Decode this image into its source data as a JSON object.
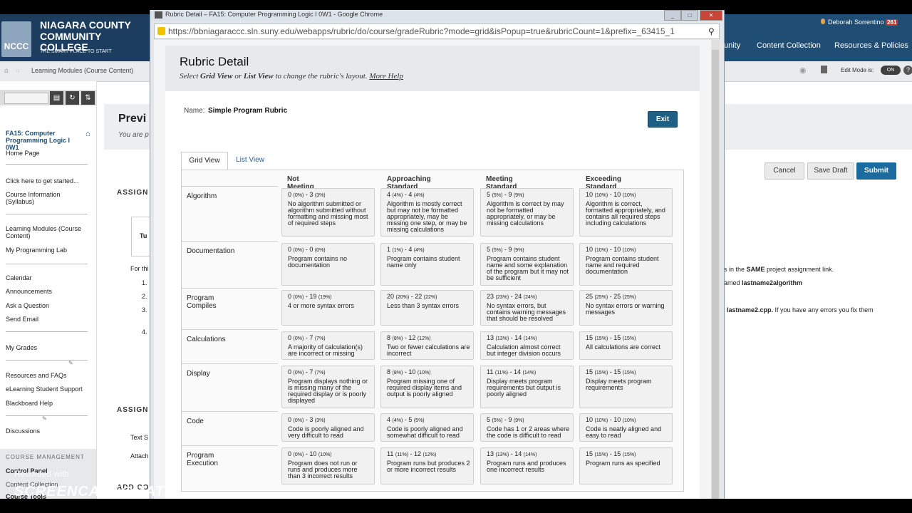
{
  "bg": {
    "college_line1": "NIAGARA COUNTY",
    "college_line2": "COMMUNITY COLLEGE",
    "tagline": "THE SMART PLACE TO START",
    "logo_text": "NCCC",
    "nav": [
      "unity",
      "Content Collection",
      "Resources & Policies"
    ],
    "user_name": "Deborah Sorrentino",
    "user_count": "261",
    "breadcrumb": "Learning Modules (Course Content)",
    "edit_mode_label": "Edit Mode is:",
    "edit_mode_value": "ON",
    "course_title": "FA15: Computer Programming Logic I 0W1",
    "sidebar_groups": [
      [
        "Home Page"
      ],
      [
        "Click here to get started...",
        "Course Information (Syllabus)"
      ],
      [
        "Learning Modules (Course Content)",
        "My Programming Lab"
      ],
      [
        "Calendar",
        "Announcements",
        "Ask a Question",
        "Send Email"
      ],
      [
        "My Grades"
      ],
      [
        "Resources and FAQs",
        "eLearning Student Support",
        "Blackboard Help"
      ],
      [
        "Discussions"
      ]
    ],
    "course_management": "COURSE MANAGEMENT",
    "control_panel": "Control Panel",
    "content_collection": "Content Collection",
    "course_tools": "Course Tools",
    "preview_title": "Previ",
    "preview_sub": "You are p",
    "buttons": {
      "cancel": "Cancel",
      "save_draft": "Save Draft",
      "submit": "Submit"
    },
    "assign_h1": "ASSIGN",
    "assign_h2": "ASSIGN",
    "add_h": "ADD CO",
    "tu": "Tu",
    "for_text": "For thi",
    "list_nums": [
      "1.",
      "2.",
      "3.",
      "4."
    ],
    "text_s": "Text S",
    "attach": "Attach",
    "same_text_pre": "s in the ",
    "same_text_bold": "SAME",
    "same_text_post": " project assignment link.",
    "named_pre": "amed ",
    "named_bold": "lastname2algorithm",
    "errors_bold": "lastname2.cpp.",
    "errors_post": "  If you have any errors you fix them"
  },
  "popup": {
    "window_title": "Rubric Detail – FA15: Computer Programming Logic I 0W1 - Google Chrome",
    "url": "https://bbniagaraccc.sln.suny.edu/webapps/rubric/do/course/gradeRubric?mode=grid&isPopup=true&rubricCount=1&prefix=_63415_1",
    "heading": "Rubric Detail",
    "sub_pre": "Select ",
    "sub_grid": "Grid View",
    "sub_mid": " or ",
    "sub_list": "List View",
    "sub_post": " to change the rubric's layout.",
    "more_help": "More Help",
    "name_label": "Name:",
    "name_value": "Simple Program Rubric",
    "exit": "Exit",
    "tab_grid": "Grid View",
    "tab_list": "List View"
  },
  "rubric": {
    "columns": [
      "Not Meeting Standard",
      "Approaching Standard",
      "Meeting Standard",
      "Exceeding Standard"
    ],
    "rows": [
      {
        "name": "Algorithm",
        "cells": [
          {
            "pts": "0",
            "pct": "(0%)",
            "pts2": "3",
            "pct2": "(3%)",
            "desc": "No algorithm submitted or algorithm submitted without formatting and missing most of required steps"
          },
          {
            "pts": "4",
            "pct": "(4%)",
            "pts2": "4",
            "pct2": "(4%)",
            "desc": "Algorithm is mostly correct but may not be formatted appropriately, may be missing one step, or may be missing calculations"
          },
          {
            "pts": "5",
            "pct": "(5%)",
            "pts2": "9",
            "pct2": "(9%)",
            "desc": "Algorithm is correct by may not be formatted appropriately, or may be missing calculations"
          },
          {
            "pts": "10",
            "pct": "(10%)",
            "pts2": "10",
            "pct2": "(10%)",
            "desc": "Algorithm is correct, formatted appropriately, and contains all required steps including calculations"
          }
        ]
      },
      {
        "name": "Documentation",
        "cells": [
          {
            "pts": "0",
            "pct": "(0%)",
            "pts2": "0",
            "pct2": "(0%)",
            "desc": "Program contains no documentation"
          },
          {
            "pts": "1",
            "pct": "(1%)",
            "pts2": "4",
            "pct2": "(4%)",
            "desc": "Program contains student name only"
          },
          {
            "pts": "5",
            "pct": "(5%)",
            "pts2": "9",
            "pct2": "(9%)",
            "desc": "Program contains student name and some explanation of the program but it may not be sufficient"
          },
          {
            "pts": "10",
            "pct": "(10%)",
            "pts2": "10",
            "pct2": "(10%)",
            "desc": "Program contains student name and required documentation"
          }
        ]
      },
      {
        "name": "Program Compiles",
        "cells": [
          {
            "pts": "0",
            "pct": "(0%)",
            "pts2": "19",
            "pct2": "(19%)",
            "desc": "4 or more syntax errors"
          },
          {
            "pts": "20",
            "pct": "(20%)",
            "pts2": "22",
            "pct2": "(22%)",
            "desc": "Less than 3 syntax errors"
          },
          {
            "pts": "23",
            "pct": "(23%)",
            "pts2": "24",
            "pct2": "(24%)",
            "desc": "No syntax errors, but contains warning messages that should be resolved"
          },
          {
            "pts": "25",
            "pct": "(25%)",
            "pts2": "25",
            "pct2": "(25%)",
            "desc": "No syntax errors or warning messages"
          }
        ]
      },
      {
        "name": "Calculations",
        "cells": [
          {
            "pts": "0",
            "pct": "(0%)",
            "pts2": "7",
            "pct2": "(7%)",
            "desc": "A majority of calculation(s) are incorrect or missing"
          },
          {
            "pts": "8",
            "pct": "(8%)",
            "pts2": "12",
            "pct2": "(12%)",
            "desc": "Two or fewer calculations are incorrect"
          },
          {
            "pts": "13",
            "pct": "(13%)",
            "pts2": "14",
            "pct2": "(14%)",
            "desc": "Calculation almost correct but integer division occurs"
          },
          {
            "pts": "15",
            "pct": "(15%)",
            "pts2": "15",
            "pct2": "(15%)",
            "desc": "All calculations are correct"
          }
        ]
      },
      {
        "name": "Display",
        "cells": [
          {
            "pts": "0",
            "pct": "(0%)",
            "pts2": "7",
            "pct2": "(7%)",
            "desc": "Program displays nothing or is missing many of the required display or is poorly displayed"
          },
          {
            "pts": "8",
            "pct": "(8%)",
            "pts2": "10",
            "pct2": "(10%)",
            "desc": "Program missing one of required display items and output is poorly aligned"
          },
          {
            "pts": "11",
            "pct": "(11%)",
            "pts2": "14",
            "pct2": "(14%)",
            "desc": "Display meets program requirements but output is poorly aligned"
          },
          {
            "pts": "15",
            "pct": "(15%)",
            "pts2": "15",
            "pct2": "(15%)",
            "desc": "Display meets program requirements"
          }
        ]
      },
      {
        "name": "Code",
        "cells": [
          {
            "pts": "0",
            "pct": "(0%)",
            "pts2": "3",
            "pct2": "(3%)",
            "desc": "Code is poorly aligned and very difficult to read"
          },
          {
            "pts": "4",
            "pct": "(4%)",
            "pts2": "5",
            "pct2": "(5%)",
            "desc": "Code is poorly aligned and somewhat difficult to read"
          },
          {
            "pts": "5",
            "pct": "(5%)",
            "pts2": "9",
            "pct2": "(9%)",
            "desc": "Code has 1 or 2 areas where the code is difficult to read"
          },
          {
            "pts": "10",
            "pct": "(10%)",
            "pts2": "10",
            "pct2": "(10%)",
            "desc": "Code is neatly aligned and easy to read"
          }
        ]
      },
      {
        "name": "Program Execution",
        "cells": [
          {
            "pts": "0",
            "pct": "(0%)",
            "pts2": "10",
            "pct2": "(10%)",
            "desc": "Program does not run or runs and produces more than 3 incorrect results"
          },
          {
            "pts": "11",
            "pct": "(11%)",
            "pts2": "12",
            "pct2": "(12%)",
            "desc": "Program runs but produces 2 or more incorrect results"
          },
          {
            "pts": "13",
            "pct": "(13%)",
            "pts2": "14",
            "pct2": "(14%)",
            "desc": "Program runs and produces one incorrect results"
          },
          {
            "pts": "15",
            "pct": "(15%)",
            "pts2": "15",
            "pct2": "(15%)",
            "desc": "Program runs as specified"
          }
        ]
      }
    ]
  },
  "watermark": {
    "line1": "Recorded with",
    "line2": "SCREENCAST◎MATIC"
  },
  "colors": {
    "header": "#1f4d74",
    "accent": "#1b6b9e",
    "exit": "#1e5f85"
  }
}
